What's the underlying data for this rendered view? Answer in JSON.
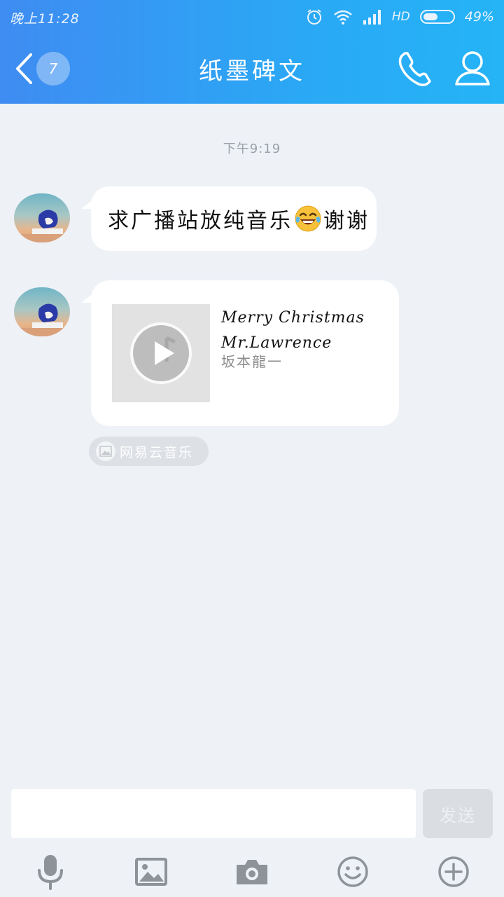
{
  "status_bar": {
    "time": "晚上11:28",
    "network": "HD",
    "battery_pct": "49%",
    "battery_level": 0.49
  },
  "nav": {
    "unread_count": "7",
    "title": "纸墨碑文"
  },
  "chat": {
    "timestamp": "下午9:19",
    "messages": [
      {
        "type": "text",
        "text_before_emoji": "求广播站放纯音乐",
        "emoji": "face-with-tears-of-joy",
        "text_after_emoji": "谢谢"
      },
      {
        "type": "music",
        "title": "Merry  Christmas Mr.Lawrence",
        "artist": "坂本龍一",
        "source": "网易云音乐"
      }
    ]
  },
  "input": {
    "value": "",
    "send_label": "发送"
  },
  "toolbar": {
    "icons": [
      "microphone-icon",
      "image-icon",
      "camera-icon",
      "emoji-icon",
      "plus-icon"
    ]
  },
  "colors": {
    "header_start": "#3f8cf2",
    "header_end": "#25b4f6",
    "background": "#eef1f6"
  }
}
